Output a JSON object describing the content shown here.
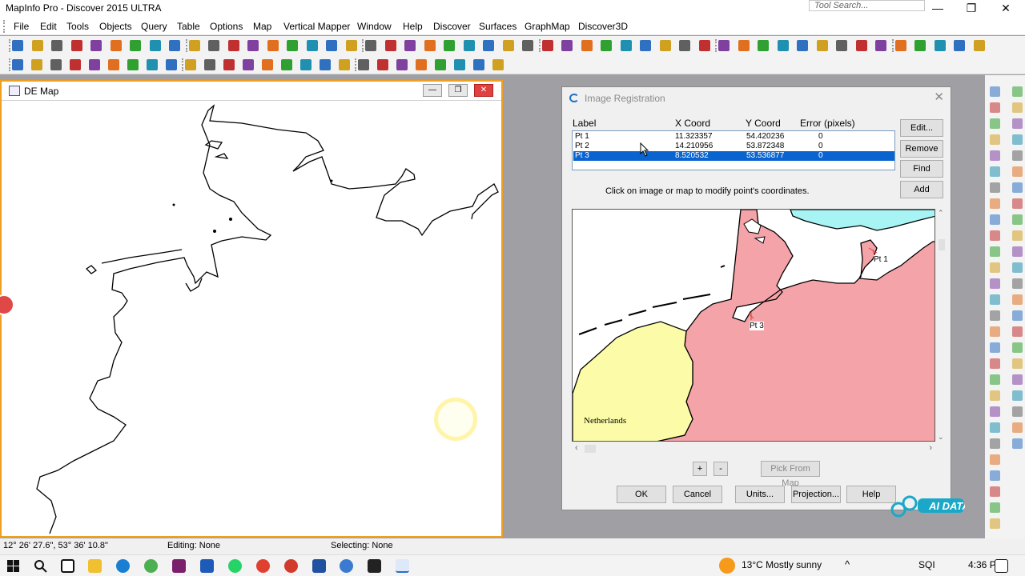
{
  "app": {
    "title": "MapInfo Pro - Discover 2015    ULTRA",
    "tool_search_placeholder": "Tool Search..."
  },
  "menu": [
    "File",
    "Edit",
    "Tools",
    "Objects",
    "Query",
    "Table",
    "Options",
    "Map",
    "Vertical Mapper",
    "Window",
    "Help",
    "Discover",
    "Surfaces",
    "GraphMap",
    "Discover3D"
  ],
  "map_window": {
    "title": "DE Map"
  },
  "dialog": {
    "title": "Image Registration",
    "columns": {
      "label": "Label",
      "x": "X Coord",
      "y": "Y Coord",
      "error": "Error (pixels)"
    },
    "rows": [
      {
        "label": "Pt 1",
        "x": "11.323357",
        "y": "54.420236",
        "error": "0",
        "selected": false
      },
      {
        "label": "Pt 2",
        "x": "14.210956",
        "y": "53.872348",
        "error": "0",
        "selected": false
      },
      {
        "label": "Pt 3",
        "x": "8.520532",
        "y": "53.536877",
        "error": "0",
        "selected": true
      }
    ],
    "side_buttons": {
      "edit": "Edit...",
      "remove": "Remove",
      "find": "Find",
      "add": "Add"
    },
    "instruction": "Click on image or map to modify point's coordinates.",
    "map_labels": {
      "netherlands": "Netherlands",
      "pt1": "Pt 1",
      "pt3": "Pt 3"
    },
    "zoom_in": "+",
    "zoom_out": "-",
    "pick_from_map": "Pick From Map",
    "bottom_buttons": {
      "ok": "OK",
      "cancel": "Cancel",
      "units": "Units...",
      "projection": "Projection...",
      "help": "Help"
    },
    "colors": {
      "germany": "#f4a3a8",
      "netherlands": "#fcfca8",
      "denmark": "#a8f4f4"
    }
  },
  "status": {
    "coords": "12° 26' 27.6\", 53° 36' 10.8\"",
    "editing": "Editing: None",
    "selecting": "Selecting: None"
  },
  "watermark": "AI DATA",
  "taskbar": {
    "weather_temp": "13°C",
    "weather_text": "Mostly sunny",
    "lang": "SQI",
    "time": "4:36 PM"
  }
}
